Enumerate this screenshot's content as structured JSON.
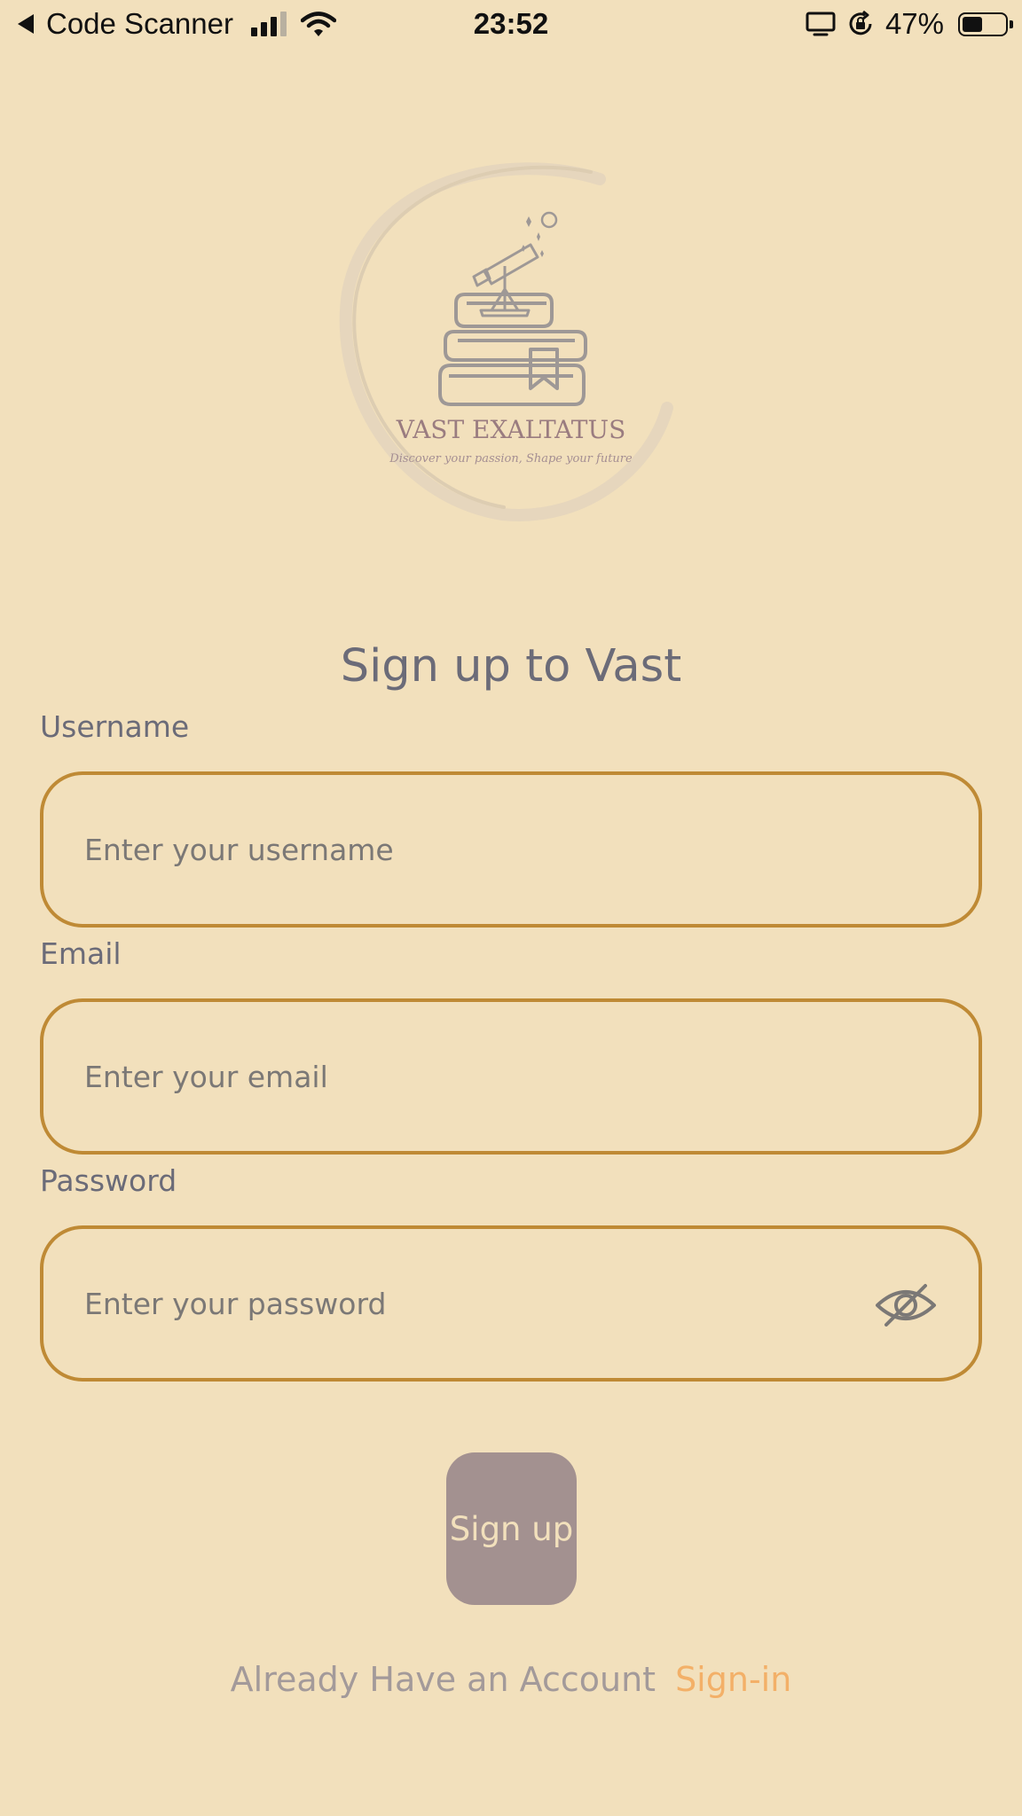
{
  "status_bar": {
    "back_app": "Code Scanner",
    "time": "23:52",
    "battery_percent": "47%",
    "battery_level": 0.47,
    "signal_bars": 3,
    "icons": [
      "back-arrow-icon",
      "cellular-signal-icon",
      "wifi-icon",
      "screen-mirroring-icon",
      "orientation-lock-icon",
      "battery-icon"
    ]
  },
  "logo": {
    "title": "VAST EXALTATUS",
    "tagline": "Discover your passion, Shape your future",
    "icon": "telescope-books-icon"
  },
  "form": {
    "title": "Sign up to Vast",
    "username": {
      "label": "Username",
      "placeholder": "Enter your username",
      "value": ""
    },
    "email": {
      "label": "Email",
      "placeholder": "Enter your email",
      "value": ""
    },
    "password": {
      "label": "Password",
      "placeholder": "Enter your password",
      "value": "",
      "toggle_icon": "eye-slash-icon"
    },
    "submit_label": "Sign up"
  },
  "footer": {
    "prompt": "Already Have an Account",
    "link": "Sign-in"
  },
  "colors": {
    "background": "#f2e0bc",
    "field_border": "#bf8a35",
    "button": "#a39190",
    "link": "#f3b068",
    "text": "#6b6b78"
  }
}
